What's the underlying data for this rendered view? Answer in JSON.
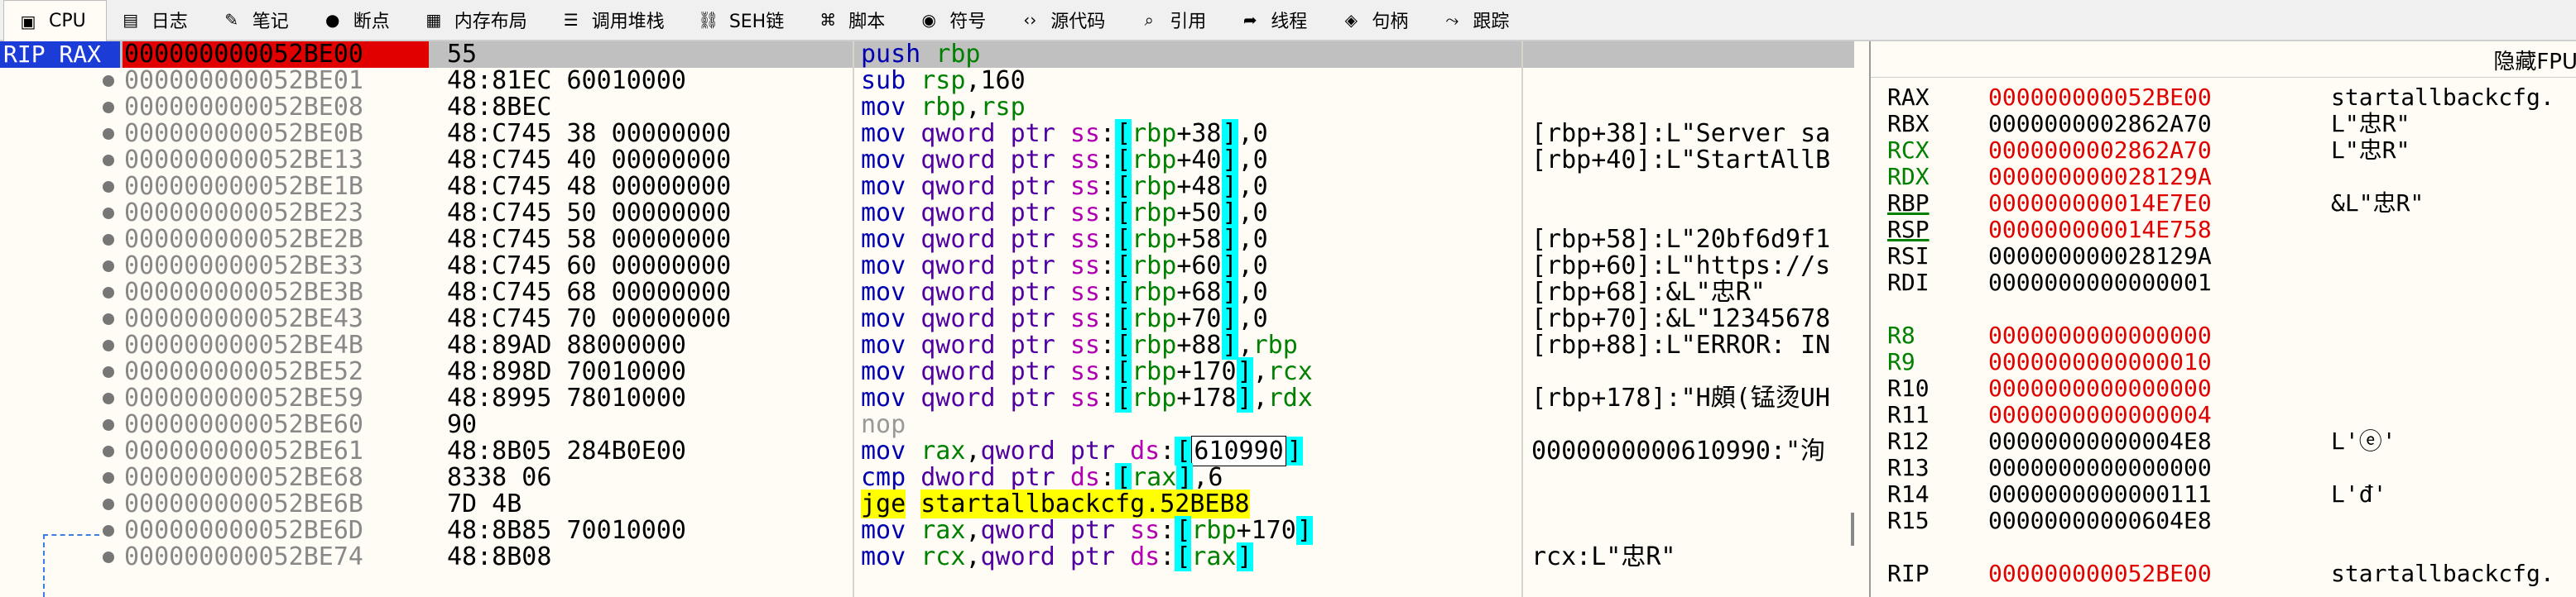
{
  "tabs": [
    {
      "label": "CPU",
      "icon": "cpu-icon",
      "glyph": "▣",
      "active": true
    },
    {
      "label": "日志",
      "icon": "log-icon",
      "glyph": "▤"
    },
    {
      "label": "笔记",
      "icon": "notes-icon",
      "glyph": "✎"
    },
    {
      "label": "断点",
      "icon": "breakpoint-icon",
      "glyph": "●"
    },
    {
      "label": "内存布局",
      "icon": "memory-map-icon",
      "glyph": "▦"
    },
    {
      "label": "调用堆栈",
      "icon": "call-stack-icon",
      "glyph": "☰"
    },
    {
      "label": "SEH链",
      "icon": "seh-chain-icon",
      "glyph": "⛓"
    },
    {
      "label": "脚本",
      "icon": "script-icon",
      "glyph": "⌘"
    },
    {
      "label": "符号",
      "icon": "symbols-icon",
      "glyph": "◉"
    },
    {
      "label": "源代码",
      "icon": "source-icon",
      "glyph": "‹›"
    },
    {
      "label": "引用",
      "icon": "references-icon",
      "glyph": "⌕"
    },
    {
      "label": "线程",
      "icon": "threads-icon",
      "glyph": "➦"
    },
    {
      "label": "句柄",
      "icon": "handles-icon",
      "glyph": "◈"
    },
    {
      "label": "跟踪",
      "icon": "trace-icon",
      "glyph": "⤳"
    }
  ],
  "disasm": {
    "rip_label": "RIP RAX",
    "rows": [
      {
        "addr": "000000000052BE00",
        "bytes": "55",
        "instr": "push rbp",
        "comment": "",
        "current": true
      },
      {
        "addr": "000000000052BE01",
        "bytes": "48:81EC 60010000",
        "instr": "sub rsp,160",
        "comment": ""
      },
      {
        "addr": "000000000052BE08",
        "bytes": "48:8BEC",
        "instr": "mov rbp,rsp",
        "comment": ""
      },
      {
        "addr": "000000000052BE0B",
        "bytes": "48:C745 38 00000000",
        "instr": "mov qword ptr ss:[rbp+38],0",
        "comment": "[rbp+38]:L\"Server sa"
      },
      {
        "addr": "000000000052BE13",
        "bytes": "48:C745 40 00000000",
        "instr": "mov qword ptr ss:[rbp+40],0",
        "comment": "[rbp+40]:L\"StartAllB"
      },
      {
        "addr": "000000000052BE1B",
        "bytes": "48:C745 48 00000000",
        "instr": "mov qword ptr ss:[rbp+48],0",
        "comment": ""
      },
      {
        "addr": "000000000052BE23",
        "bytes": "48:C745 50 00000000",
        "instr": "mov qword ptr ss:[rbp+50],0",
        "comment": ""
      },
      {
        "addr": "000000000052BE2B",
        "bytes": "48:C745 58 00000000",
        "instr": "mov qword ptr ss:[rbp+58],0",
        "comment": "[rbp+58]:L\"20bf6d9f1"
      },
      {
        "addr": "000000000052BE33",
        "bytes": "48:C745 60 00000000",
        "instr": "mov qword ptr ss:[rbp+60],0",
        "comment": "[rbp+60]:L\"https://s"
      },
      {
        "addr": "000000000052BE3B",
        "bytes": "48:C745 68 00000000",
        "instr": "mov qword ptr ss:[rbp+68],0",
        "comment": "[rbp+68]:&L\"忠R\""
      },
      {
        "addr": "000000000052BE43",
        "bytes": "48:C745 70 00000000",
        "instr": "mov qword ptr ss:[rbp+70],0",
        "comment": "[rbp+70]:&L\"12345678"
      },
      {
        "addr": "000000000052BE4B",
        "bytes": "48:89AD 88000000",
        "instr": "mov qword ptr ss:[rbp+88],rbp",
        "comment": "[rbp+88]:L\"ERROR: IN"
      },
      {
        "addr": "000000000052BE52",
        "bytes": "48:898D 70010000",
        "instr": "mov qword ptr ss:[rbp+170],rcx",
        "comment": ""
      },
      {
        "addr": "000000000052BE59",
        "bytes": "48:8995 78010000",
        "instr": "mov qword ptr ss:[rbp+178],rdx",
        "comment": "[rbp+178]:\"H頗(锰烫UH"
      },
      {
        "addr": "000000000052BE60",
        "bytes": "90",
        "instr": "nop",
        "comment": ""
      },
      {
        "addr": "000000000052BE61",
        "bytes": "48:8B05 284B0E00",
        "instr": "mov rax,qword ptr ds:[610990]",
        "comment": "0000000000610990:\"洵"
      },
      {
        "addr": "000000000052BE68",
        "bytes": "8338 06",
        "instr": "cmp dword ptr ds:[rax],6",
        "comment": ""
      },
      {
        "addr": "000000000052BE6B",
        "bytes": "7D 4B",
        "instr": "jge startallbackcfg.52BEB8",
        "comment": ""
      },
      {
        "addr": "000000000052BE6D",
        "bytes": "48:8B85 70010000",
        "instr": "mov rax,qword ptr ss:[rbp+170]",
        "comment": ""
      },
      {
        "addr": "000000000052BE74",
        "bytes": "48:8B08",
        "instr": "mov rcx,qword ptr ds:[rax]",
        "comment": "rcx:L\"忠R\""
      }
    ]
  },
  "registers": {
    "hide_fpu_label": "隐藏FPU",
    "rows": [
      {
        "name": "RAX",
        "value": "000000000052BE00",
        "comment": "startallbackcfg.",
        "changed": true
      },
      {
        "name": "RBX",
        "value": "0000000002862A70",
        "comment": "L\"忠R\""
      },
      {
        "name": "RCX",
        "value": "0000000002862A70",
        "comment": "L\"忠R\"",
        "changed": true
      },
      {
        "name": "RDX",
        "value": "000000000028129A",
        "comment": "",
        "changed": true
      },
      {
        "name": "RBP",
        "value": "000000000014E7E0",
        "comment": "&L\"忠R\"",
        "changed": true
      },
      {
        "name": "RSP",
        "value": "000000000014E758",
        "comment": "",
        "changed": true
      },
      {
        "name": "RSI",
        "value": "000000000028129A",
        "comment": ""
      },
      {
        "name": "RDI",
        "value": "0000000000000001",
        "comment": ""
      },
      {
        "name": "",
        "value": "",
        "comment": ""
      },
      {
        "name": "R8",
        "value": "0000000000000000",
        "comment": "",
        "changed": true
      },
      {
        "name": "R9",
        "value": "0000000000000010",
        "comment": "",
        "changed": true
      },
      {
        "name": "R10",
        "value": "0000000000000000",
        "comment": "",
        "changed": true
      },
      {
        "name": "R11",
        "value": "0000000000000004",
        "comment": "",
        "changed": true
      },
      {
        "name": "R12",
        "value": "00000000000004E8",
        "comment": "L'ⓔ'"
      },
      {
        "name": "R13",
        "value": "0000000000000000",
        "comment": ""
      },
      {
        "name": "R14",
        "value": "0000000000000111",
        "comment": "L'đ'"
      },
      {
        "name": "R15",
        "value": "00000000000604E8",
        "comment": ""
      },
      {
        "name": "",
        "value": "",
        "comment": ""
      },
      {
        "name": "RIP",
        "value": "000000000052BE00",
        "comment": "startallbackcfg.",
        "changed": true
      }
    ]
  }
}
